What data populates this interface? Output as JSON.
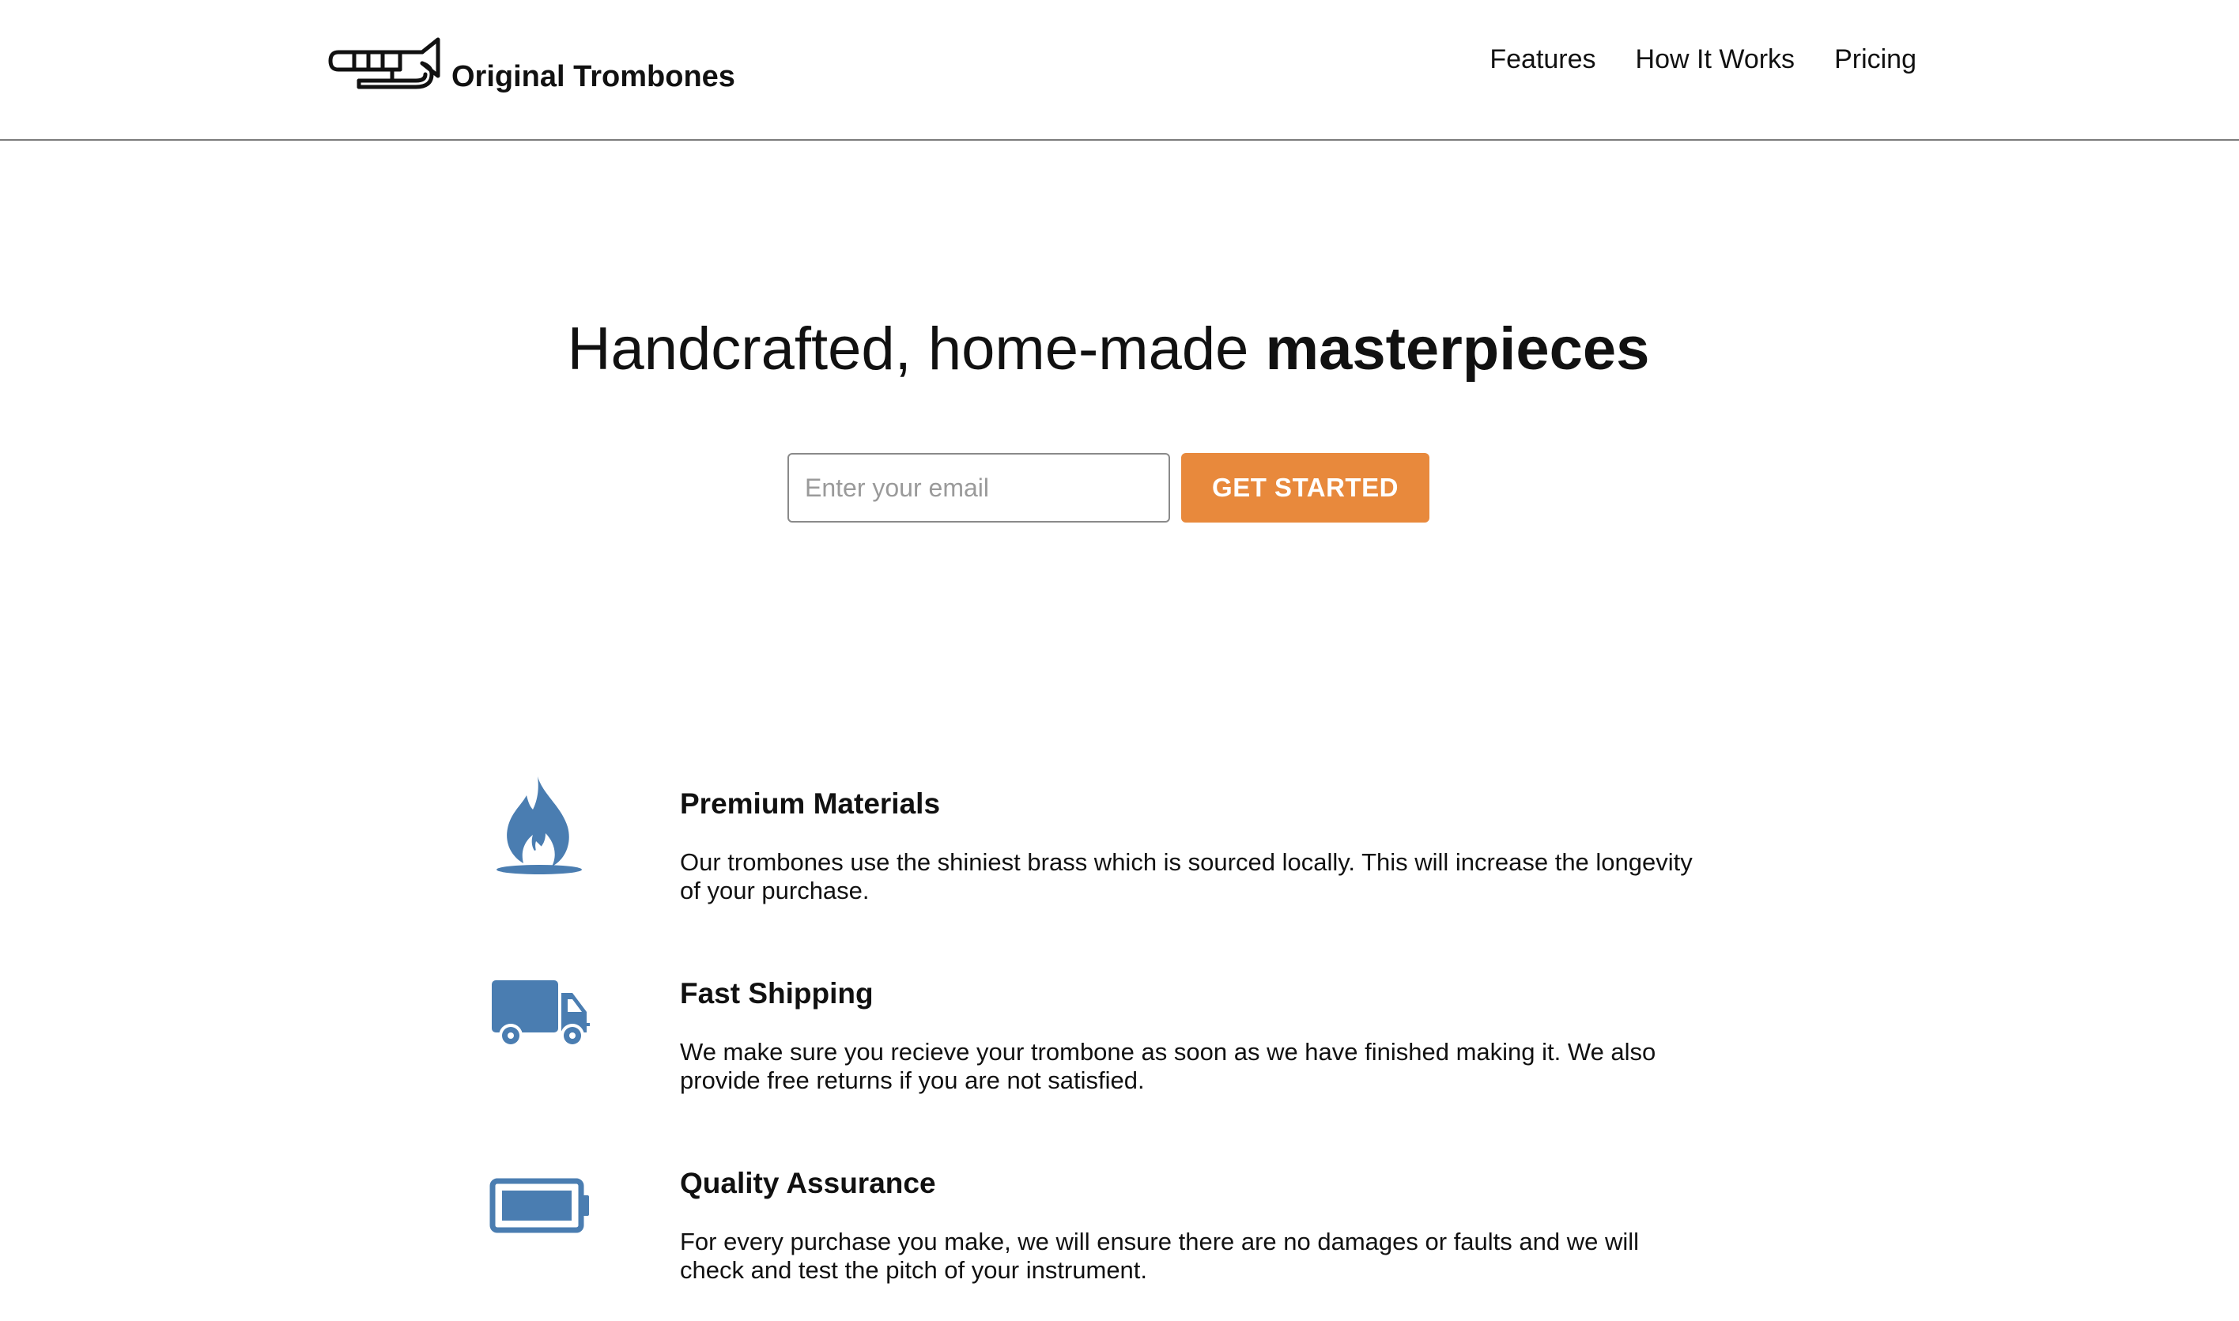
{
  "header": {
    "brand_name": "Original Trombones",
    "logo_icon": "trombone-icon",
    "nav": [
      {
        "label": "Features"
      },
      {
        "label": "How It Works"
      },
      {
        "label": "Pricing"
      }
    ]
  },
  "hero": {
    "title_regular": "Handcrafted, home-made ",
    "title_bold": "masterpieces",
    "email_placeholder": "Enter your email",
    "cta_label": "GET STARTED"
  },
  "features": [
    {
      "icon": "fire-icon",
      "title": "Premium Materials",
      "text": "Our trombones use the shiniest brass which is sourced locally. This will increase the longevity of your purchase."
    },
    {
      "icon": "truck-icon",
      "title": "Fast Shipping",
      "text": "We make sure you recieve your trombone as soon as we have finished making it. We also provide free returns if you are not satisfied."
    },
    {
      "icon": "battery-icon",
      "title": "Quality Assurance",
      "text": "For every purchase you make, we will ensure there are no damages or faults and we will check and test the pitch of your instrument."
    }
  ],
  "colors": {
    "accent": "#e8893c",
    "icon": "#4a7db1",
    "text": "#111111",
    "divider": "#7c7c7c"
  }
}
